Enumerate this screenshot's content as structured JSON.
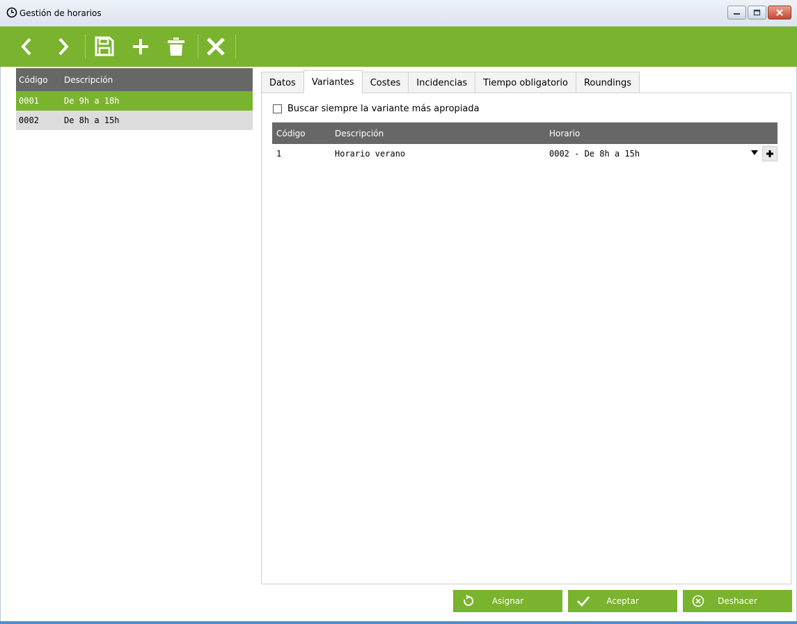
{
  "window": {
    "title": "Gestión de horarios",
    "icon": "clock-icon"
  },
  "toolbar": {
    "buttons": [
      "previous-icon",
      "next-icon",
      "save-icon",
      "add-icon",
      "delete-icon",
      "close-icon"
    ]
  },
  "colors": {
    "accent": "#7ab32e",
    "header": "#676767",
    "row_alt": "#dcdcdc"
  },
  "left_list": {
    "columns": [
      "Código",
      "Descripción"
    ],
    "rows": [
      {
        "code": "0001",
        "description": "De 9h a 18h",
        "selected": true
      },
      {
        "code": "0002",
        "description": "De 8h a 15h",
        "selected": false
      }
    ]
  },
  "tabs": [
    {
      "label": "Datos",
      "active": false
    },
    {
      "label": "Variantes",
      "active": true
    },
    {
      "label": "Costes",
      "active": false
    },
    {
      "label": "Incidencias",
      "active": false
    },
    {
      "label": "Tiempo obligatorio",
      "active": false
    },
    {
      "label": "Roundings",
      "active": false
    }
  ],
  "variants": {
    "checkbox_label": "Buscar siempre la variante más apropiada",
    "checkbox_checked": false,
    "columns": [
      "Código",
      "Descripción",
      "Horario"
    ],
    "rows": [
      {
        "code": "1",
        "description": "Horario verano",
        "schedule": "0002 - De 8h a 15h"
      }
    ]
  },
  "footer": {
    "assign": "Asignar",
    "accept": "Aceptar",
    "undo": "Deshacer"
  }
}
